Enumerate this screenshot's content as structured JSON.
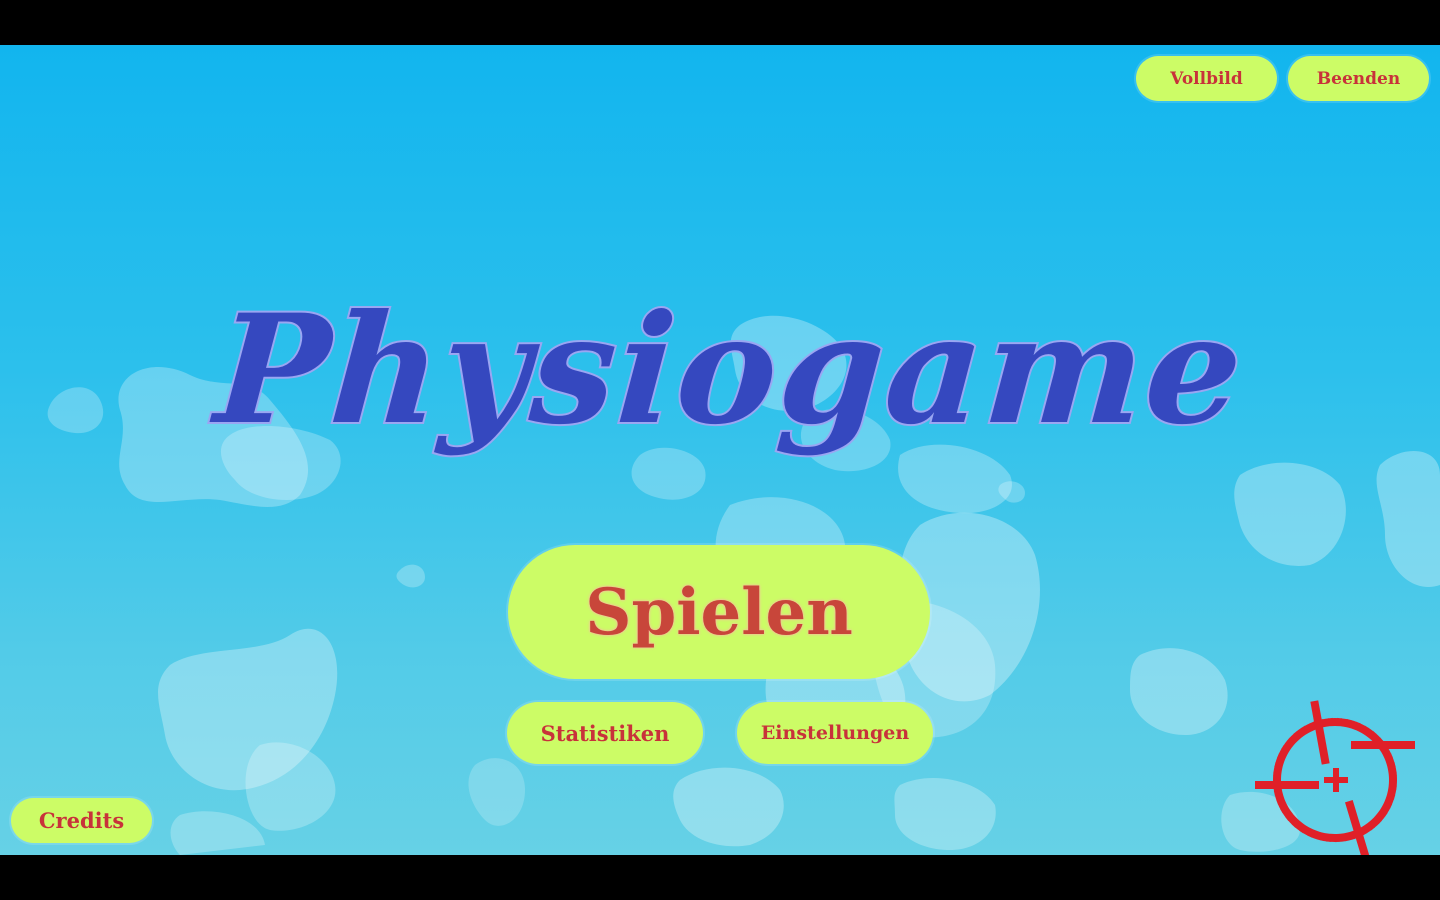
{
  "game": {
    "title": "Physiogame"
  },
  "top_bar": {
    "fullscreen_label": "Vollbild",
    "quit_label": "Beenden"
  },
  "main_menu": {
    "play_label": "Spielen",
    "statistics_label": "Statistiken",
    "settings_label": "Einstellungen"
  },
  "footer": {
    "credits_label": "Credits"
  },
  "cursor": {
    "icon": "crosshair-icon",
    "color": "#e02028"
  },
  "colors": {
    "button_bg": "#ccfc66",
    "button_text": "#c8323a",
    "title_fill": "#3548bf",
    "title_outline": "#9aa6f2",
    "sky_top": "#12b5ee",
    "sky_bottom": "#66d1e6"
  }
}
